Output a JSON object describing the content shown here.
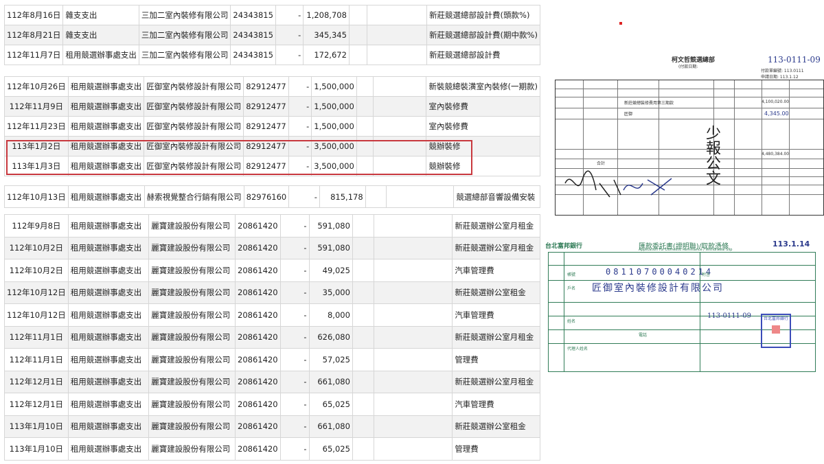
{
  "table_design": {
    "rows": [
      {
        "date": "112年8月16日",
        "category": "雜支支出",
        "vendor": "三加二室內裝修有限公司",
        "tax_id": "24343815",
        "dash": "-",
        "amount": "1,208,708",
        "note": "新莊競選總部設計費(頭款%)"
      },
      {
        "date": "112年8月21日",
        "category": "雜支支出",
        "vendor": "三加二室內裝修有限公司",
        "tax_id": "24343815",
        "dash": "-",
        "amount": "345,345",
        "note": "新莊競選總部設計費(期中款%)"
      },
      {
        "date": "112年11月7日",
        "category": "租用競選辦事處支出",
        "vendor": "三加二室內裝修有限公司",
        "tax_id": "24343815",
        "dash": "-",
        "amount": "172,672",
        "note": "新莊競選總部設計費"
      }
    ]
  },
  "table_renovation": {
    "rows": [
      {
        "date": "112年10月26日",
        "category": "租用競選辦事處支出",
        "vendor": "匠御室內裝修設計有限公司",
        "tax_id": "82912477",
        "dash": "-",
        "amount": "1,500,000",
        "note": "新裝競總裝潢室內裝修(一期款)"
      },
      {
        "date": "112年11月9日",
        "category": "租用競選辦事處支出",
        "vendor": "匠御室內裝修設計有限公司",
        "tax_id": "82912477",
        "dash": "-",
        "amount": "1,500,000",
        "note": "室內裝修費"
      },
      {
        "date": "112年11月23日",
        "category": "租用競選辦事處支出",
        "vendor": "匠御室內裝修設計有限公司",
        "tax_id": "82912477",
        "dash": "-",
        "amount": "1,500,000",
        "note": "室內裝修費"
      },
      {
        "date": "113年1月2日",
        "category": "租用競選辦事處支出",
        "vendor": "匠御室內裝修設計有限公司",
        "tax_id": "82912477",
        "dash": "-",
        "amount": "3,500,000",
        "note": "競辦裝修"
      },
      {
        "date": "113年1月3日",
        "category": "租用競選辦事處支出",
        "vendor": "匠御室內裝修設計有限公司",
        "tax_id": "82912477",
        "dash": "-",
        "amount": "3,500,000",
        "note": "競辦裝修"
      }
    ]
  },
  "table_audio": {
    "rows": [
      {
        "date": "112年10月13日",
        "category": "租用競選辦事處支出",
        "vendor": "赫索視覺整合行銷有限公司",
        "tax_id": "82976160",
        "dash": "-",
        "amount": "815,178",
        "note": "競選總部音響設備安裝"
      }
    ]
  },
  "table_rent": {
    "rows": [
      {
        "date": "112年9月8日",
        "category": "租用競選辦事處支出",
        "vendor": "麗寶建設股份有限公司",
        "tax_id": "20861420",
        "dash": "-",
        "amount": "591,080",
        "note": "新莊競選辦公室月租金"
      },
      {
        "date": "112年10月2日",
        "category": "租用競選辦事處支出",
        "vendor": "麗寶建設股份有限公司",
        "tax_id": "20861420",
        "dash": "-",
        "amount": "591,080",
        "note": "新莊競選辦公室月租金"
      },
      {
        "date": "112年10月2日",
        "category": "租用競選辦事處支出",
        "vendor": "麗寶建設股份有限公司",
        "tax_id": "20861420",
        "dash": "-",
        "amount": "49,025",
        "note": "汽車管理費"
      },
      {
        "date": "112年10月12日",
        "category": "租用競選辦事處支出",
        "vendor": "麗寶建設股份有限公司",
        "tax_id": "20861420",
        "dash": "-",
        "amount": "35,000",
        "note": "新莊競選辦公室租金"
      },
      {
        "date": "112年10月12日",
        "category": "租用競選辦事處支出",
        "vendor": "麗寶建設股份有限公司",
        "tax_id": "20861420",
        "dash": "-",
        "amount": "8,000",
        "note": "汽車管理費"
      },
      {
        "date": "112年11月1日",
        "category": "租用競選辦事處支出",
        "vendor": "麗寶建設股份有限公司",
        "tax_id": "20861420",
        "dash": "-",
        "amount": "626,080",
        "note": "新莊競選辦公室月租金"
      },
      {
        "date": "112年11月1日",
        "category": "租用競選辦事處支出",
        "vendor": "麗寶建設股份有限公司",
        "tax_id": "20861420",
        "dash": "-",
        "amount": "57,025",
        "note": "管理費"
      },
      {
        "date": "112年12月1日",
        "category": "租用競選辦事處支出",
        "vendor": "麗寶建設股份有限公司",
        "tax_id": "20861420",
        "dash": "-",
        "amount": "661,080",
        "note": "新莊競選辦公室月租金"
      },
      {
        "date": "112年12月1日",
        "category": "租用競選辦事處支出",
        "vendor": "麗寶建設股份有限公司",
        "tax_id": "20861420",
        "dash": "-",
        "amount": "65,025",
        "note": "汽車管理費"
      },
      {
        "date": "113年1月10日",
        "category": "租用競選辦事處支出",
        "vendor": "麗寶建設股份有限公司",
        "tax_id": "20861420",
        "dash": "-",
        "amount": "661,080",
        "note": "新莊競選辦公室租金"
      },
      {
        "date": "113年1月10日",
        "category": "租用競選辦事處支出",
        "vendor": "麗寶建設股份有限公司",
        "tax_id": "20861420",
        "dash": "-",
        "amount": "65,025",
        "note": "管理費"
      }
    ]
  },
  "voucher": {
    "title": "柯文哲競選總部",
    "subtitle": "(付款日期:",
    "handwritten_no": "113-0111-09",
    "meta_line1": "付款單編號: 113.0111",
    "meta_line2": "申請日期: 113.1.12",
    "item1": "新莊競總裝修費用第三期款",
    "item2": "匠御",
    "amount1": "4,100,020.00",
    "amount_hw": "4,345.00",
    "total": "4,480,384.00",
    "sum_label": "合計",
    "signature": "少報公文"
  },
  "slip": {
    "bank": "台北富邦銀行",
    "title": "匯款委託書(證明聯)/取款憑條",
    "subtitle_en": "Application For Domestic Remittance / Withdrawal Slip",
    "date": "113.1.14",
    "account": "08110700040214",
    "payee": "匠御室內裝修設計有限公司",
    "handwritten_no": "113-0111-09",
    "stamp_text": "台北富邦銀行",
    "labels": {
      "account": "帳號",
      "payee": "戶名",
      "name": "姓名",
      "phone": "電話",
      "agent": "代理人姓名",
      "remark": "附言"
    }
  }
}
